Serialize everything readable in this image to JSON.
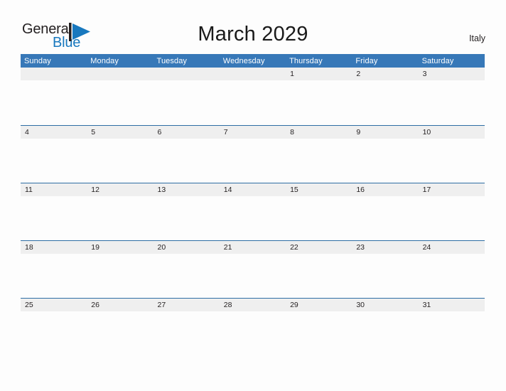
{
  "brand": {
    "name_part1": "General",
    "name_part2": "Blue",
    "mark": "blue-triangle-flag-icon",
    "color_dark": "#231f20",
    "color_blue": "#1878be"
  },
  "header": {
    "title": "March 2029",
    "locale": "Italy"
  },
  "theme": {
    "header_blue": "#3778b8",
    "separator_blue": "#2e6da4",
    "band_gray": "#efefef",
    "page_background": "#fdfdfd",
    "text_dark": "#231f20"
  },
  "calendar": {
    "month": "March",
    "year": "2029",
    "weekdays": [
      "Sunday",
      "Monday",
      "Tuesday",
      "Wednesday",
      "Thursday",
      "Friday",
      "Saturday"
    ],
    "weeks": [
      [
        "",
        "",
        "",
        "",
        "1",
        "2",
        "3"
      ],
      [
        "4",
        "5",
        "6",
        "7",
        "8",
        "9",
        "10"
      ],
      [
        "11",
        "12",
        "13",
        "14",
        "15",
        "16",
        "17"
      ],
      [
        "18",
        "19",
        "20",
        "21",
        "22",
        "23",
        "24"
      ],
      [
        "25",
        "26",
        "27",
        "28",
        "29",
        "30",
        "31"
      ]
    ]
  }
}
